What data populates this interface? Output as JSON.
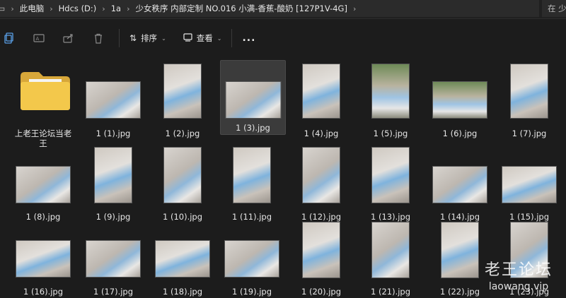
{
  "address": {
    "crumbs": [
      "此电脑",
      "Hdcs (D:)",
      "1a",
      "少女秩序 内部定制 NO.016 小满-香蕉-酸奶 [127P1V-4G]"
    ],
    "search_placeholder": "在 少"
  },
  "toolbar": {
    "sort_label": "排序",
    "view_label": "查看",
    "more_label": "..."
  },
  "folder": {
    "name": "上老王论坛当老王"
  },
  "files": [
    "1 (1).jpg",
    "1 (2).jpg",
    "1 (3).jpg",
    "1 (4).jpg",
    "1 (5).jpg",
    "1 (6).jpg",
    "1 (7).jpg",
    "1 (8).jpg",
    "1 (9).jpg",
    "1 (10).jpg",
    "1 (11).jpg",
    "1 (12).jpg",
    "1 (13).jpg",
    "1 (14).jpg",
    "1 (15).jpg",
    "1 (16).jpg",
    "1 (17).jpg",
    "1 (18).jpg",
    "1 (19).jpg",
    "1 (20).jpg",
    "1 (21).jpg",
    "1 (22).jpg",
    "1 (23).jpg"
  ],
  "watermark": {
    "cn": "老王论坛",
    "en": "laowang.vip"
  }
}
